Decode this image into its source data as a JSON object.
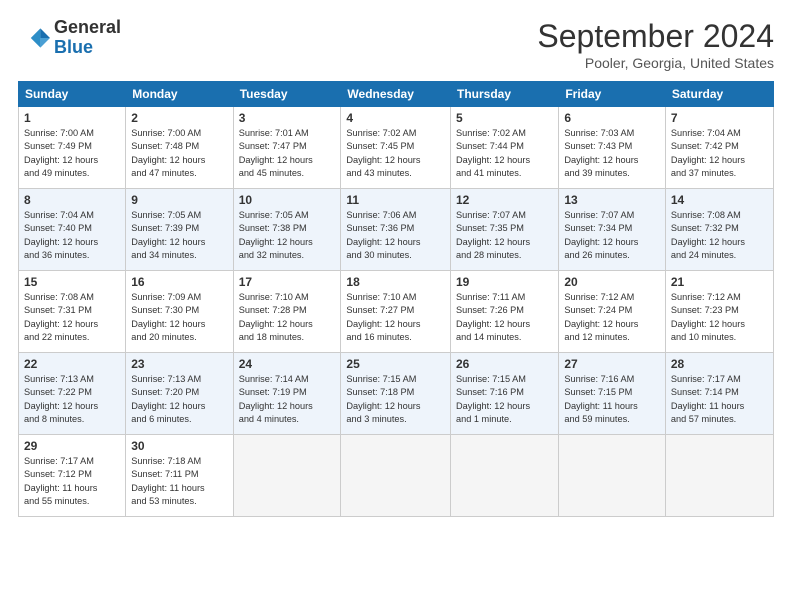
{
  "header": {
    "logo_general": "General",
    "logo_blue": "Blue",
    "month_title": "September 2024",
    "location": "Pooler, Georgia, United States"
  },
  "weekdays": [
    "Sunday",
    "Monday",
    "Tuesday",
    "Wednesday",
    "Thursday",
    "Friday",
    "Saturday"
  ],
  "weeks": [
    [
      {
        "day": "1",
        "info": "Sunrise: 7:00 AM\nSunset: 7:49 PM\nDaylight: 12 hours\nand 49 minutes."
      },
      {
        "day": "2",
        "info": "Sunrise: 7:00 AM\nSunset: 7:48 PM\nDaylight: 12 hours\nand 47 minutes."
      },
      {
        "day": "3",
        "info": "Sunrise: 7:01 AM\nSunset: 7:47 PM\nDaylight: 12 hours\nand 45 minutes."
      },
      {
        "day": "4",
        "info": "Sunrise: 7:02 AM\nSunset: 7:45 PM\nDaylight: 12 hours\nand 43 minutes."
      },
      {
        "day": "5",
        "info": "Sunrise: 7:02 AM\nSunset: 7:44 PM\nDaylight: 12 hours\nand 41 minutes."
      },
      {
        "day": "6",
        "info": "Sunrise: 7:03 AM\nSunset: 7:43 PM\nDaylight: 12 hours\nand 39 minutes."
      },
      {
        "day": "7",
        "info": "Sunrise: 7:04 AM\nSunset: 7:42 PM\nDaylight: 12 hours\nand 37 minutes."
      }
    ],
    [
      {
        "day": "8",
        "info": "Sunrise: 7:04 AM\nSunset: 7:40 PM\nDaylight: 12 hours\nand 36 minutes."
      },
      {
        "day": "9",
        "info": "Sunrise: 7:05 AM\nSunset: 7:39 PM\nDaylight: 12 hours\nand 34 minutes."
      },
      {
        "day": "10",
        "info": "Sunrise: 7:05 AM\nSunset: 7:38 PM\nDaylight: 12 hours\nand 32 minutes."
      },
      {
        "day": "11",
        "info": "Sunrise: 7:06 AM\nSunset: 7:36 PM\nDaylight: 12 hours\nand 30 minutes."
      },
      {
        "day": "12",
        "info": "Sunrise: 7:07 AM\nSunset: 7:35 PM\nDaylight: 12 hours\nand 28 minutes."
      },
      {
        "day": "13",
        "info": "Sunrise: 7:07 AM\nSunset: 7:34 PM\nDaylight: 12 hours\nand 26 minutes."
      },
      {
        "day": "14",
        "info": "Sunrise: 7:08 AM\nSunset: 7:32 PM\nDaylight: 12 hours\nand 24 minutes."
      }
    ],
    [
      {
        "day": "15",
        "info": "Sunrise: 7:08 AM\nSunset: 7:31 PM\nDaylight: 12 hours\nand 22 minutes."
      },
      {
        "day": "16",
        "info": "Sunrise: 7:09 AM\nSunset: 7:30 PM\nDaylight: 12 hours\nand 20 minutes."
      },
      {
        "day": "17",
        "info": "Sunrise: 7:10 AM\nSunset: 7:28 PM\nDaylight: 12 hours\nand 18 minutes."
      },
      {
        "day": "18",
        "info": "Sunrise: 7:10 AM\nSunset: 7:27 PM\nDaylight: 12 hours\nand 16 minutes."
      },
      {
        "day": "19",
        "info": "Sunrise: 7:11 AM\nSunset: 7:26 PM\nDaylight: 12 hours\nand 14 minutes."
      },
      {
        "day": "20",
        "info": "Sunrise: 7:12 AM\nSunset: 7:24 PM\nDaylight: 12 hours\nand 12 minutes."
      },
      {
        "day": "21",
        "info": "Sunrise: 7:12 AM\nSunset: 7:23 PM\nDaylight: 12 hours\nand 10 minutes."
      }
    ],
    [
      {
        "day": "22",
        "info": "Sunrise: 7:13 AM\nSunset: 7:22 PM\nDaylight: 12 hours\nand 8 minutes."
      },
      {
        "day": "23",
        "info": "Sunrise: 7:13 AM\nSunset: 7:20 PM\nDaylight: 12 hours\nand 6 minutes."
      },
      {
        "day": "24",
        "info": "Sunrise: 7:14 AM\nSunset: 7:19 PM\nDaylight: 12 hours\nand 4 minutes."
      },
      {
        "day": "25",
        "info": "Sunrise: 7:15 AM\nSunset: 7:18 PM\nDaylight: 12 hours\nand 3 minutes."
      },
      {
        "day": "26",
        "info": "Sunrise: 7:15 AM\nSunset: 7:16 PM\nDaylight: 12 hours\nand 1 minute."
      },
      {
        "day": "27",
        "info": "Sunrise: 7:16 AM\nSunset: 7:15 PM\nDaylight: 11 hours\nand 59 minutes."
      },
      {
        "day": "28",
        "info": "Sunrise: 7:17 AM\nSunset: 7:14 PM\nDaylight: 11 hours\nand 57 minutes."
      }
    ],
    [
      {
        "day": "29",
        "info": "Sunrise: 7:17 AM\nSunset: 7:12 PM\nDaylight: 11 hours\nand 55 minutes."
      },
      {
        "day": "30",
        "info": "Sunrise: 7:18 AM\nSunset: 7:11 PM\nDaylight: 11 hours\nand 53 minutes."
      },
      {
        "day": "",
        "info": ""
      },
      {
        "day": "",
        "info": ""
      },
      {
        "day": "",
        "info": ""
      },
      {
        "day": "",
        "info": ""
      },
      {
        "day": "",
        "info": ""
      }
    ]
  ]
}
